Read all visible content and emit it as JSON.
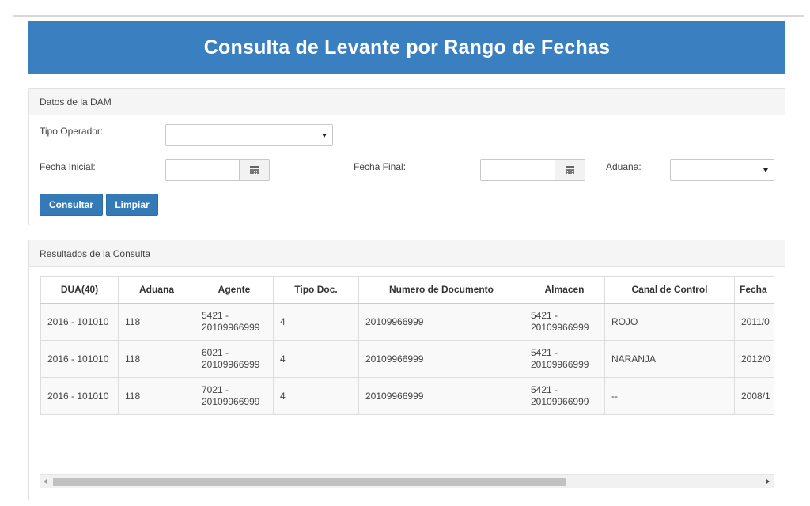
{
  "page": {
    "title": "Consulta de Levante por Rango de Fechas"
  },
  "dam_panel": {
    "heading": "Datos de la DAM",
    "tipo_operador_label": "Tipo Operador:",
    "tipo_operador_value": "",
    "fecha_inicial_label": "Fecha Inicial:",
    "fecha_inicial_value": "",
    "fecha_final_label": "Fecha Final:",
    "fecha_final_value": "",
    "aduana_label": "Aduana:",
    "aduana_value": "",
    "consultar_label": "Consultar",
    "limpiar_label": "Limpiar"
  },
  "results_panel": {
    "heading": "Resultados de la Consulta",
    "columns": [
      "DUA(40)",
      "Aduana",
      "Agente",
      "Tipo Doc.",
      "Numero de Documento",
      "Almacen",
      "Canal de Control",
      "Fecha"
    ],
    "rows": [
      [
        "2016 - 101010",
        "118",
        "5421 - 20109966999",
        "4",
        "20109966999",
        "5421 - 20109966999",
        "ROJO",
        "2011/0"
      ],
      [
        "2016 - 101010",
        "118",
        "6021 - 20109966999",
        "4",
        "20109966999",
        "5421 - 20109966999",
        "NARANJA",
        "2012/0"
      ],
      [
        "2016 - 101010",
        "118",
        "7021 - 20109966999",
        "4",
        "20109966999",
        "5421 - 20109966999",
        "--",
        "2008/1"
      ]
    ]
  },
  "scrollbar": {
    "horizontal_position": 0
  },
  "colors": {
    "header_bg": "#3a7fbf",
    "button_bg": "#337ab7"
  },
  "icons": {
    "date_picker": "calendar-icon",
    "dropdown": "caret-down-icon",
    "scroll_left": "arrow-left-icon",
    "scroll_right": "arrow-right-icon"
  }
}
